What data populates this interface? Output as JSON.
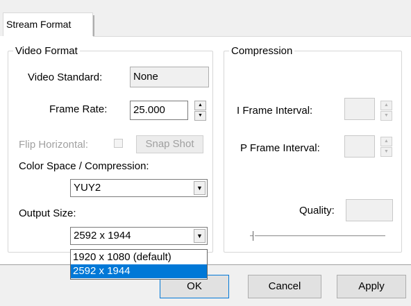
{
  "tabs": [
    {
      "label": "Stream Format"
    }
  ],
  "video_format": {
    "title": "Video Format",
    "video_standard_label": "Video Standard:",
    "video_standard_value": "None",
    "frame_rate_label": "Frame Rate:",
    "frame_rate_value": "25.000",
    "flip_horizontal_label": "Flip Horizontal:",
    "snap_shot_label": "Snap Shot",
    "color_space_label": "Color Space / Compression:",
    "color_space_value": "YUY2",
    "output_size_label": "Output Size:",
    "output_size_value": "2592 x 1944",
    "output_size_options": [
      "1920 x 1080  (default)",
      "2592 x 1944"
    ],
    "output_size_selected_index": 1
  },
  "compression": {
    "title": "Compression",
    "i_frame_label": "I Frame Interval:",
    "i_frame_value": "",
    "p_frame_label": "P Frame Interval:",
    "p_frame_value": "",
    "quality_label": "Quality:",
    "quality_value": "",
    "quality_slider_level": 0
  },
  "buttons": {
    "ok": "OK",
    "cancel": "Cancel",
    "apply": "Apply"
  },
  "icons": {
    "spin_up": "up-arrow-icon",
    "spin_down": "down-arrow-icon",
    "dropdown": "chevron-down-icon"
  },
  "colors": {
    "selection": "#0078d7",
    "panel": "#ffffff",
    "dialog": "#f0f0f0"
  }
}
